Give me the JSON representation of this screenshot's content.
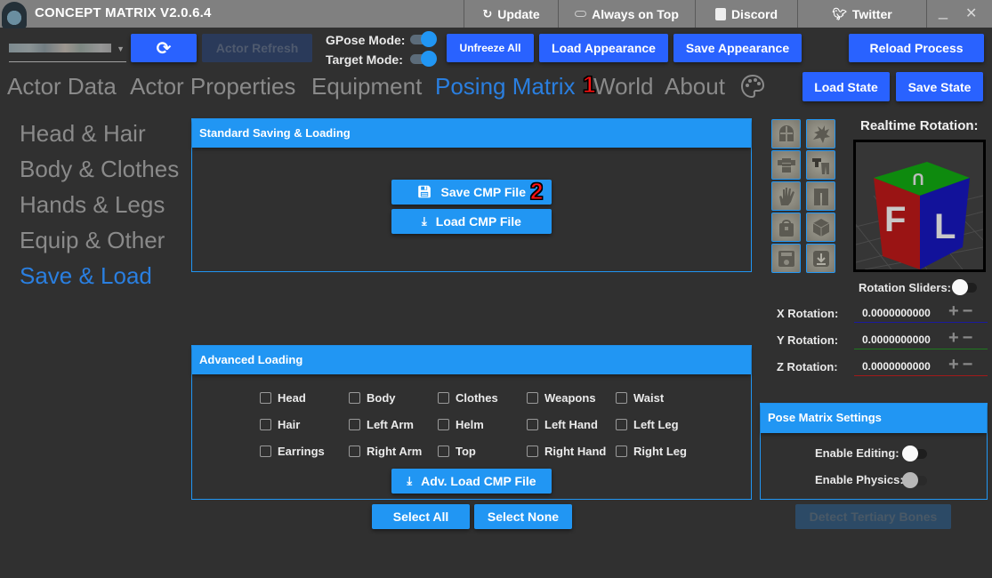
{
  "app": {
    "title": "CONCEPT MATRIX V2.0.6.4",
    "titlebar_buttons": [
      {
        "label": "Update",
        "icon": "update-icon"
      },
      {
        "label": "Always on Top",
        "icon": "pin-toggle-icon"
      },
      {
        "label": "Discord",
        "icon": "discord-icon"
      },
      {
        "label": "Twitter",
        "icon": "twitter-icon"
      }
    ],
    "window_controls": {
      "minimize": "_",
      "close": "✕"
    }
  },
  "toolbar": {
    "actor_select_value": "(blurred actor name)",
    "refresh_icon": "⟳",
    "actor_refresh": "Actor Refresh",
    "gpose_label": "GPose Mode:",
    "gpose_on": true,
    "target_label": "Target Mode:",
    "target_on": true,
    "unfreeze_all": "Unfreeze All",
    "load_appearance": "Load Appearance",
    "save_appearance": "Save Appearance",
    "reload_process": "Reload Process",
    "load_state": "Load State",
    "save_state": "Save State"
  },
  "main_tabs": [
    {
      "label": "Actor Data",
      "active": false
    },
    {
      "label": "Actor Properties",
      "active": false
    },
    {
      "label": "Equipment",
      "active": false
    },
    {
      "label": "Posing Matrix",
      "active": true
    },
    {
      "label": "World",
      "active": false
    },
    {
      "label": "About",
      "active": false
    }
  ],
  "annotations": {
    "one": "1",
    "two": "2"
  },
  "sub_tabs": [
    {
      "label": "Head & Hair",
      "active": false
    },
    {
      "label": "Body & Clothes",
      "active": false
    },
    {
      "label": "Hands & Legs",
      "active": false
    },
    {
      "label": "Equip & Other",
      "active": false
    },
    {
      "label": "Save & Load",
      "active": true
    }
  ],
  "standard_panel": {
    "title": "Standard Saving & Loading",
    "save_cmp": "Save CMP File",
    "load_cmp": "Load CMP File"
  },
  "advanced_panel": {
    "title": "Advanced Loading",
    "checkboxes": [
      [
        "Head",
        "Body",
        "Clothes",
        "Weapons",
        "Waist"
      ],
      [
        "Hair",
        "Left Arm",
        "Helm",
        "Left Hand",
        "Left Leg"
      ],
      [
        "Earrings",
        "Right Arm",
        "Top",
        "Right Hand",
        "Right Leg"
      ]
    ],
    "adv_load": "Adv. Load CMP File",
    "select_all": "Select All",
    "select_none": "Select None"
  },
  "bone_buttons": [
    "helmet-icon",
    "hair-icon",
    "armor-icon",
    "clothes-icon",
    "hand-icon",
    "legs-icon",
    "bag-icon",
    "random-dice-icon",
    "floppy-save-icon",
    "download-icon"
  ],
  "rotation": {
    "title": "Realtime Rotation:",
    "cube_faces": {
      "front": "F",
      "left": "L",
      "up": "U"
    },
    "sliders_label": "Rotation Sliders:",
    "sliders_on": false,
    "x_label": "X Rotation:",
    "x_value": "0.0000000000",
    "x_color": "#1a1aa0",
    "y_label": "Y Rotation:",
    "y_value": "0.0000000000",
    "y_color": "#1e7a1e",
    "z_label": "Z Rotation:",
    "z_value": "0.0000000000",
    "z_color": "#a01a1a"
  },
  "pose_settings": {
    "title": "Pose Matrix Settings",
    "editing_label": "Enable Editing:",
    "editing_on": false,
    "physics_label": "Enable Physics:",
    "physics_enabled": false,
    "detect_tertiary": "Detect Tertiary Bones"
  }
}
